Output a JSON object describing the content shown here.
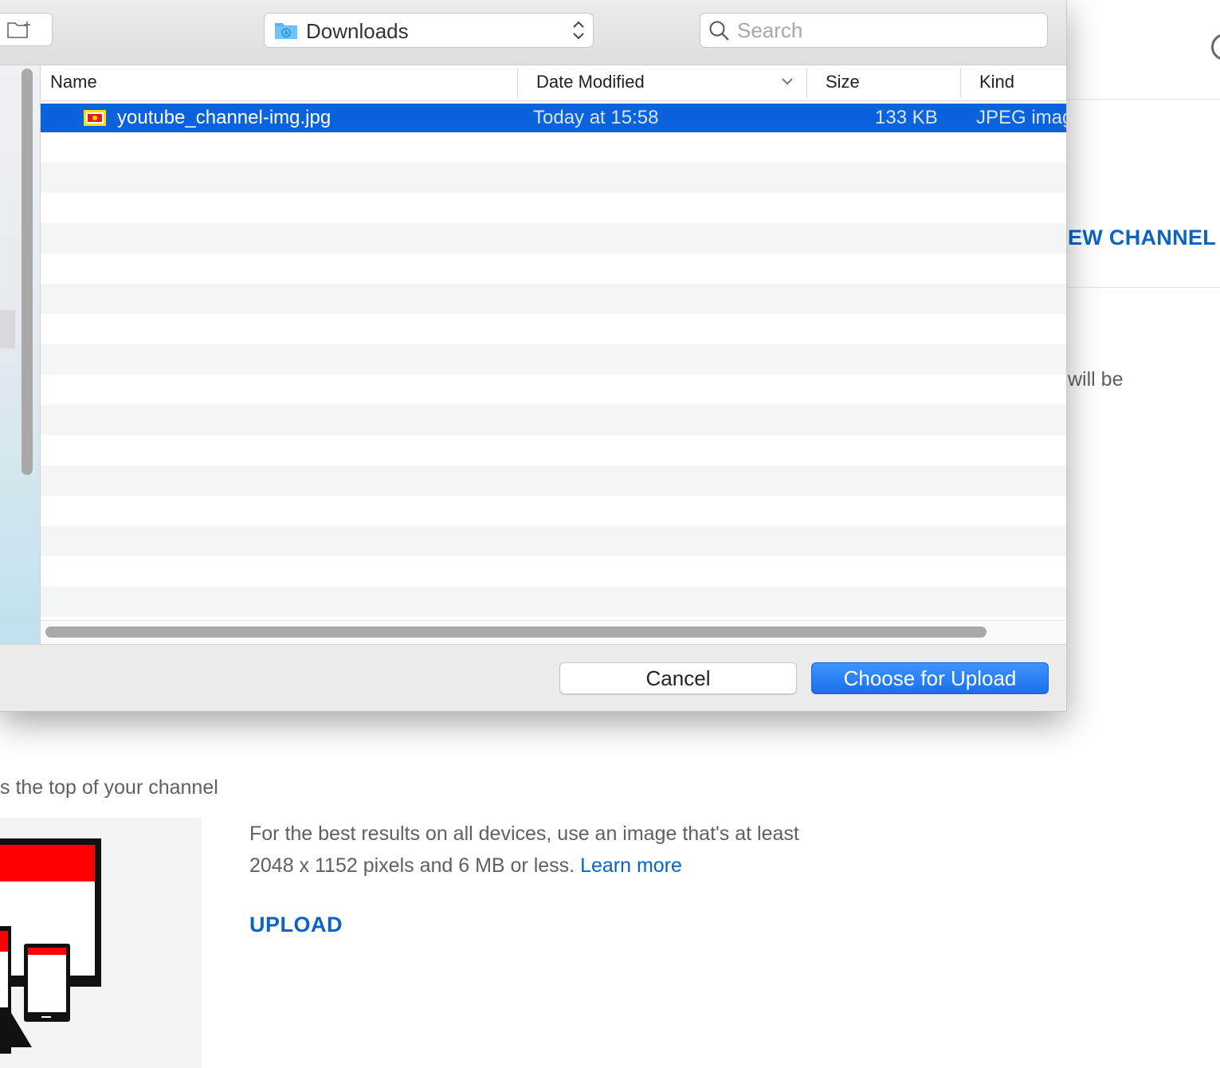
{
  "dialog": {
    "location": "Downloads",
    "search_placeholder": "Search",
    "columns": {
      "name": "Name",
      "date": "Date Modified",
      "size": "Size",
      "kind": "Kind"
    },
    "files": [
      {
        "name": "youtube_channel-img.jpg",
        "date": "Today at 15:58",
        "size": "133 KB",
        "kind": "JPEG imag"
      }
    ],
    "cancel_label": "Cancel",
    "choose_label": "Choose for Upload",
    "accent": "#0a63dc"
  },
  "page": {
    "channel_link": "EW CHANNEL",
    "will_be": "will be",
    "top_of_channel": "s the top of your channel",
    "description": "For the best results on all devices, use an image that's at least 2048 x 1152 pixels and 6 MB or less.",
    "learn_more": "Learn more",
    "upload_label": "UPLOAD",
    "link_color": "#0b63c4"
  }
}
